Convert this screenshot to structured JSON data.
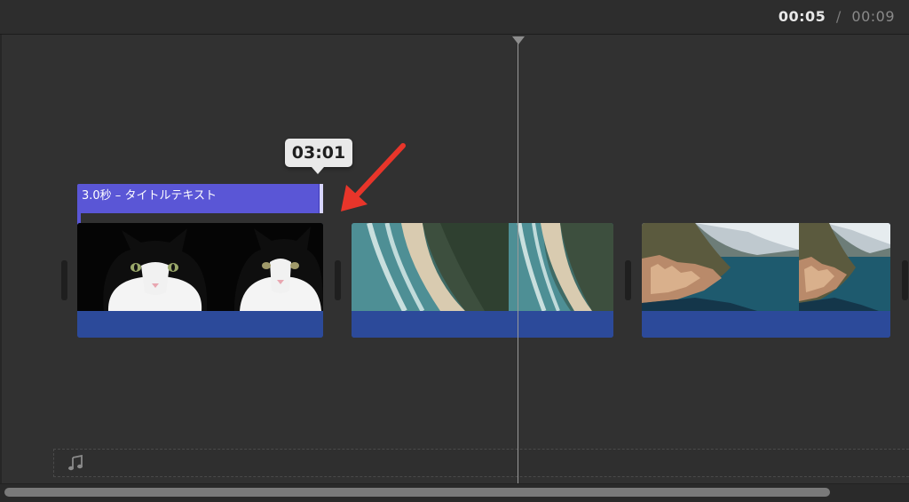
{
  "timecode": {
    "current": "00:05",
    "separator": "/",
    "total": "00:09"
  },
  "tooltip": {
    "text": "03:01"
  },
  "title_clip": {
    "label": "3.0秒 – タイトルテキスト",
    "color": "#5a56d6"
  },
  "clips": [
    {
      "name": "cat",
      "thumbnails": [
        "cat-photo",
        "cat-photo"
      ]
    },
    {
      "name": "beach",
      "thumbnails": [
        "beach-aerial",
        "beach-aerial"
      ]
    },
    {
      "name": "lake-town",
      "thumbnails": [
        "lakeside-town",
        "lakeside-town"
      ]
    }
  ],
  "colors": {
    "clip_blue": "#2c4a9a",
    "background": "#313131",
    "arrow_red": "#e8352a"
  },
  "icons": {
    "audio": "music-note-icon",
    "annotation": "red-arrow"
  }
}
